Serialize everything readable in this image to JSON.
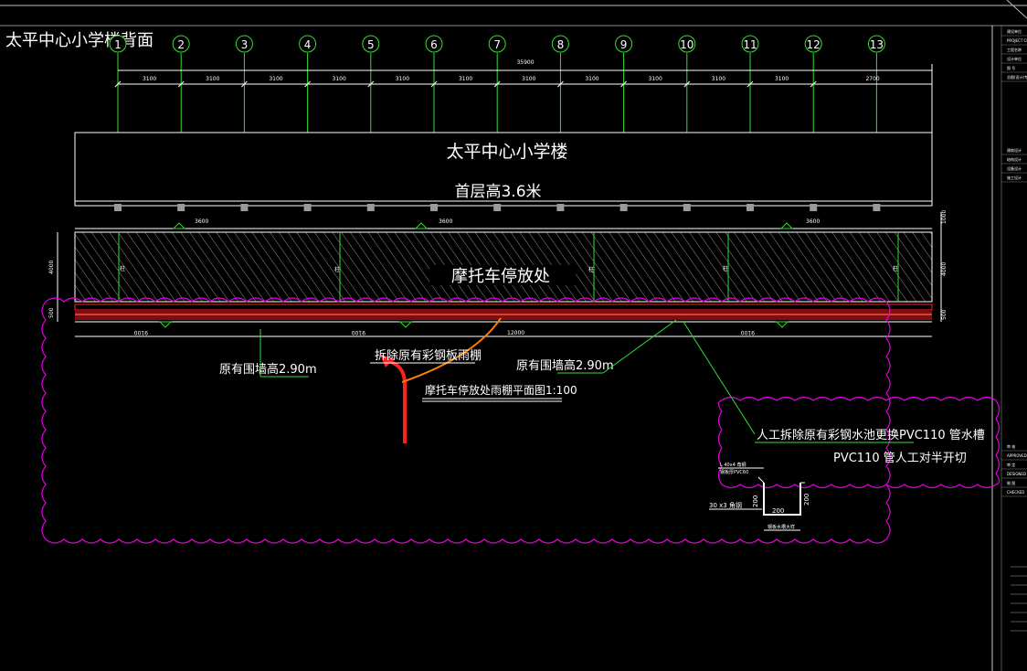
{
  "drawing": {
    "title": "太平中心小学楼背面",
    "building_name": "太平中心小学楼",
    "floor_height": "首层高3.6米",
    "parking_area": "摩托车停放处",
    "demolish_note": "拆除原有彩钢板雨棚",
    "plan_title": "摩托车停放处雨棚平面图1:100",
    "wall_height_left": "原有围墙高2.90m",
    "wall_height_right": "原有围墙高2.90m",
    "manual_note_line1": "人工拆除原有彩钢水池更换PVC110  管水槽",
    "manual_note_line2": "PVC110  管人工对半开切"
  },
  "grid_axes": [
    "1",
    "2",
    "3",
    "4",
    "5",
    "6",
    "7",
    "8",
    "9",
    "10",
    "11",
    "12",
    "13"
  ],
  "dimensions": {
    "overall": "35900",
    "bays": [
      "3100",
      "3100",
      "3100",
      "3100",
      "3100",
      "3100",
      "3100",
      "3100",
      "3100",
      "3100",
      "3100",
      "2700"
    ],
    "top_marks": [
      "3600",
      "3600",
      "3600"
    ],
    "side_top": "1000",
    "side_mid": "4000",
    "side_bot": "500",
    "left_height": "4000",
    "bottom_marks": [
      "9100",
      "9100",
      "12000",
      "9100"
    ],
    "post_label": "柱"
  },
  "detail": {
    "label1": "L 40x4 角钢",
    "label2": "钢板厚PVC60",
    "width": "200",
    "height_left": "200",
    "height_right": "200",
    "angle": "30 x3 角钢",
    "caption": "钢板水槽大样"
  },
  "title_block": {
    "rows": [
      "建设单位",
      "PROJECT CLIENT",
      "工程名称",
      "设计单位",
      "图 号",
      "总图(设计)专业",
      "建筑设计",
      "结构设计",
      "设备设计",
      "施工设计",
      "审 核",
      "APPROVED",
      "审 定",
      "DESIGNED",
      "制 图",
      "CHECKED"
    ],
    "sections": [
      "建设单位",
      "设计单位",
      "建筑设计",
      "结构设计",
      "施工设计"
    ]
  },
  "colors": {
    "background": "#000000",
    "line": "#ffffff",
    "annotation": "#2fe02f",
    "cloud": "#e000e0",
    "red": "#ff2020",
    "orange": "#ff8000"
  }
}
